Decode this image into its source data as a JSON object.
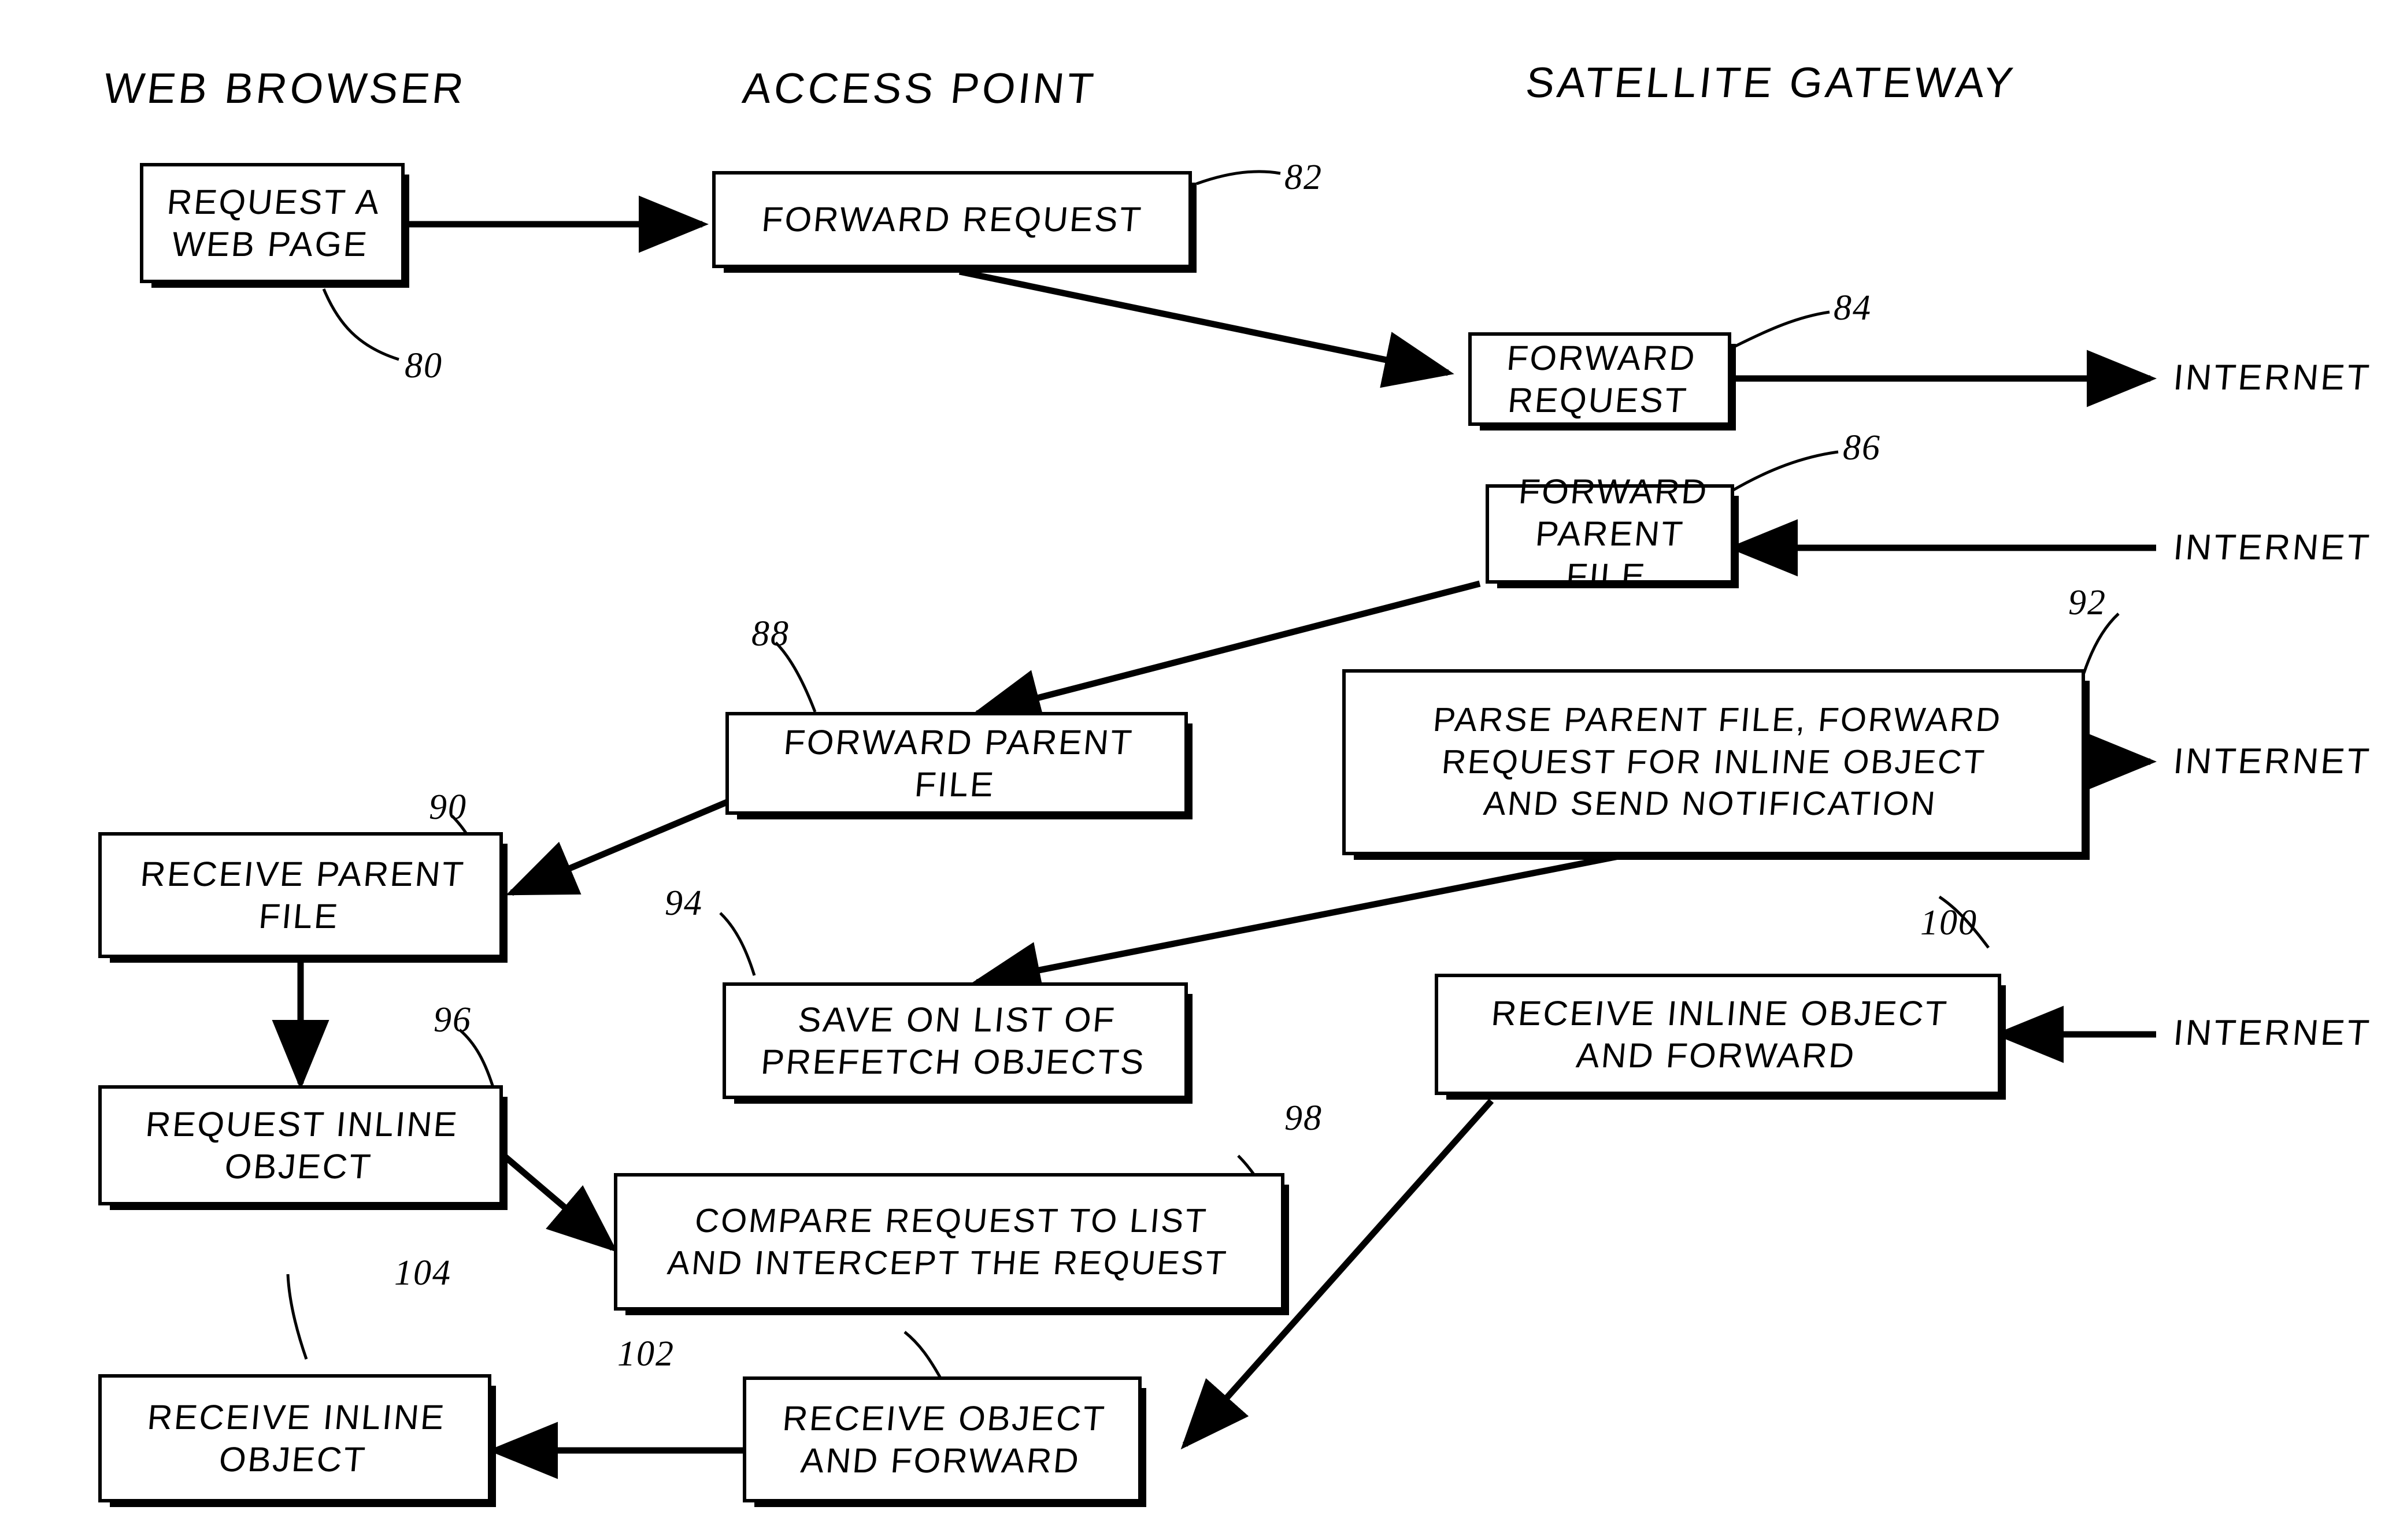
{
  "figure": {
    "type": "patent-flow-diagram",
    "background_color": "#ffffff",
    "ink_color": "#000000"
  },
  "columns": [
    {
      "id": "web-browser",
      "label": "WEB BROWSER"
    },
    {
      "id": "access-point",
      "label": "ACCESS POINT"
    },
    {
      "id": "satellite-gateway",
      "label": "SATELLITE GATEWAY"
    }
  ],
  "boxes": [
    {
      "id": "b80",
      "ref": "80",
      "column": "web-browser",
      "text": "REQUEST A\nWEB PAGE"
    },
    {
      "id": "b82",
      "ref": "82",
      "column": "access-point",
      "text": "FORWARD REQUEST"
    },
    {
      "id": "b84",
      "ref": "84",
      "column": "satellite-gateway",
      "text": "FORWARD REQUEST"
    },
    {
      "id": "b86",
      "ref": "86",
      "column": "satellite-gateway",
      "text": "FORWARD PARENT\nFILE"
    },
    {
      "id": "b88",
      "ref": "88",
      "column": "access-point",
      "text": "FORWARD PARENT\nFILE"
    },
    {
      "id": "b90",
      "ref": "90",
      "column": "web-browser",
      "text": "RECEIVE PARENT\nFILE"
    },
    {
      "id": "b92",
      "ref": "92",
      "column": "satellite-gateway",
      "text": "PARSE  PARENT FILE, FORWARD\nREQUEST FOR INLINE OBJECT\nAND SEND NOTIFICATION"
    },
    {
      "id": "b94",
      "ref": "94",
      "column": "access-point",
      "text": "SAVE ON LIST OF\nPREFETCH OBJECTS"
    },
    {
      "id": "b96",
      "ref": "96",
      "column": "web-browser",
      "text": "REQUEST INLINE\nOBJECT"
    },
    {
      "id": "b98",
      "ref": "98",
      "column": "access-point",
      "text": "COMPARE REQUEST TO LIST\nAND INTERCEPT THE REQUEST"
    },
    {
      "id": "b100",
      "ref": "100",
      "column": "satellite-gateway",
      "text": "RECEIVE INLINE OBJECT\nAND FORWARD"
    },
    {
      "id": "b102",
      "ref": "102",
      "column": "access-point",
      "text": "RECEIVE OBJECT\nAND FORWARD"
    },
    {
      "id": "b104",
      "ref": "104",
      "column": "web-browser",
      "text": "RECEIVE INLINE\nOBJECT"
    }
  ],
  "external_labels": [
    {
      "id": "net1",
      "text": "INTERNET",
      "direction": "out",
      "from": "b84"
    },
    {
      "id": "net2",
      "text": "INTERNET",
      "direction": "in",
      "to": "b86"
    },
    {
      "id": "net3",
      "text": "INTERNET",
      "direction": "out",
      "from": "b92"
    },
    {
      "id": "net4",
      "text": "INTERNET",
      "direction": "in",
      "to": "b100"
    }
  ],
  "connections": [
    {
      "from": "b80",
      "to": "b82",
      "style": "straight-arrow"
    },
    {
      "from": "b82",
      "to": "b84",
      "style": "diagonal-arrow"
    },
    {
      "from": "b86",
      "to": "b88",
      "style": "diagonal-arrow"
    },
    {
      "from": "b88",
      "to": "b90",
      "style": "diagonal-arrow"
    },
    {
      "from": "b90",
      "to": "b96",
      "style": "straight-arrow"
    },
    {
      "from": "b92",
      "to": "b94",
      "style": "diagonal-arrow"
    },
    {
      "from": "b96",
      "to": "b98",
      "style": "diagonal-arrow"
    },
    {
      "from": "b100",
      "to": "b102",
      "style": "diagonal-arrow"
    },
    {
      "from": "b102",
      "to": "b104",
      "style": "straight-arrow"
    }
  ]
}
